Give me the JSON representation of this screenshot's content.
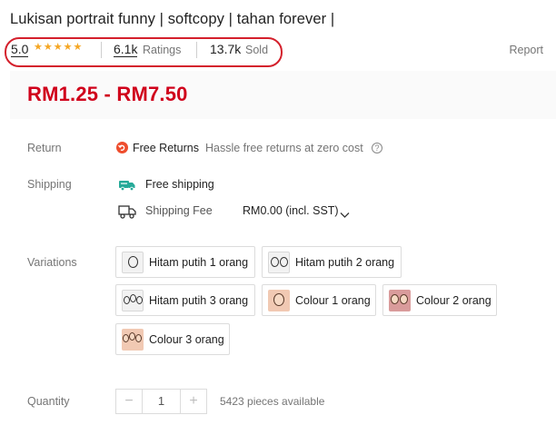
{
  "product": {
    "title": "Lukisan portrait funny | softcopy | tahan forever |",
    "rating": "5.0",
    "rating_count": "6.1k",
    "rating_label": "Ratings",
    "sold_count": "13.7k",
    "sold_label": "Sold",
    "report_label": "Report",
    "price": "RM1.25 - RM7.50"
  },
  "colors": {
    "accent": "#d0011b",
    "star": "#f5a623",
    "highlight_oval": "#d4202c",
    "shopee_orange": "#ee4d2d",
    "free_ship_teal": "#26aa99"
  },
  "return": {
    "label": "Return",
    "badge": "Free Returns",
    "description": "Hassle free returns at zero cost",
    "icon": "return-arrow-icon"
  },
  "shipping": {
    "label": "Shipping",
    "free_shipping": "Free shipping",
    "fee_label": "Shipping Fee",
    "fee_value": "RM0.00 (incl. SST)"
  },
  "variations": {
    "label": "Variations",
    "options": [
      {
        "label": "Hitam putih 1 orang"
      },
      {
        "label": "Hitam putih 2 orang"
      },
      {
        "label": "Hitam putih 3 orang"
      },
      {
        "label": "Colour 1 orang"
      },
      {
        "label": "Colour 2 orang"
      },
      {
        "label": "Colour 3 orang"
      }
    ]
  },
  "quantity": {
    "label": "Quantity",
    "value": "1",
    "minus": "−",
    "plus": "+",
    "available": "5423 pieces available"
  }
}
